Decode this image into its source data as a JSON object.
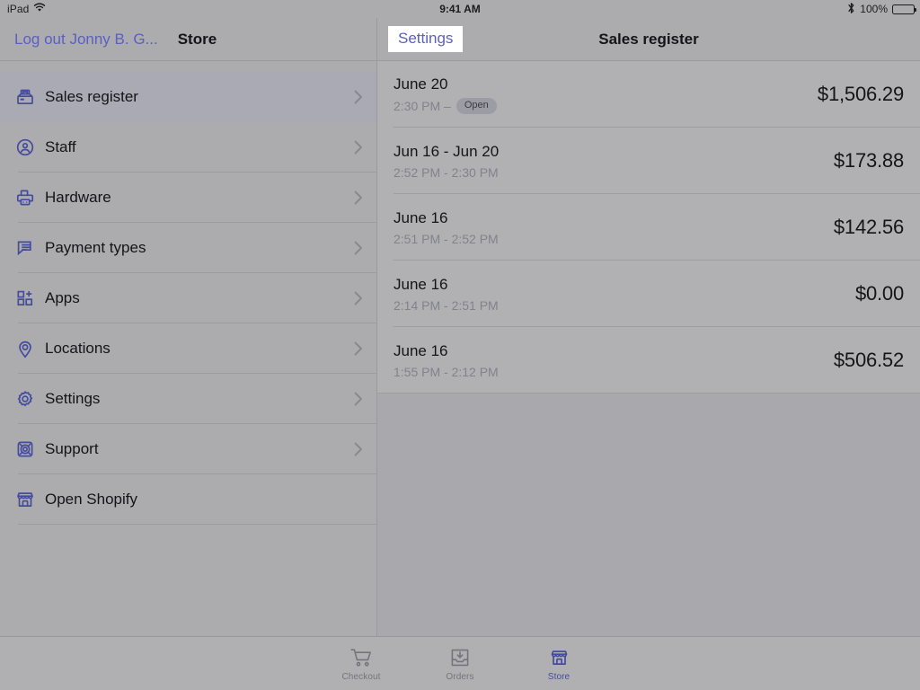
{
  "status_bar": {
    "device": "iPad",
    "wifi_icon": "wifi-icon",
    "time": "9:41 AM",
    "bluetooth_icon": "bluetooth-icon",
    "battery_percent": "100%",
    "battery_icon": "battery-full-icon"
  },
  "left_pane": {
    "navbar": {
      "logout_label": "Log out Jonny B. G...",
      "title": "Store"
    },
    "menu_items": [
      {
        "label": "Sales register",
        "icon": "cash-register-icon",
        "selected": true,
        "chevron": true
      },
      {
        "label": "Staff",
        "icon": "user-circle-icon",
        "selected": false,
        "chevron": true
      },
      {
        "label": "Hardware",
        "icon": "printer-icon",
        "selected": false,
        "chevron": true
      },
      {
        "label": "Payment types",
        "icon": "cards-stack-icon",
        "selected": false,
        "chevron": true
      },
      {
        "label": "Apps",
        "icon": "apps-grid-plus-icon",
        "selected": false,
        "chevron": true
      },
      {
        "label": "Locations",
        "icon": "map-pin-icon",
        "selected": false,
        "chevron": true
      },
      {
        "label": "Settings",
        "icon": "gear-icon",
        "selected": false,
        "chevron": true
      },
      {
        "label": "Support",
        "icon": "lifebuoy-icon",
        "selected": false,
        "chevron": true
      },
      {
        "label": "Open Shopify",
        "icon": "storefront-icon",
        "selected": false,
        "chevron": false
      }
    ]
  },
  "right_pane": {
    "navbar": {
      "settings_label": "Settings",
      "title": "Sales register"
    },
    "sales": [
      {
        "date": "June 20",
        "time": "2:30 PM –",
        "badge": "Open",
        "amount": "$1,506.29"
      },
      {
        "date": "Jun 16 - Jun 20",
        "time": "2:52 PM - 2:30 PM",
        "badge": "",
        "amount": "$173.88"
      },
      {
        "date": "June 16",
        "time": "2:51 PM - 2:52 PM",
        "badge": "",
        "amount": "$142.56"
      },
      {
        "date": "June 16",
        "time": "2:14 PM - 2:51 PM",
        "badge": "",
        "amount": "$0.00"
      },
      {
        "date": "June 16",
        "time": "1:55 PM - 2:12 PM",
        "badge": "",
        "amount": "$506.52"
      }
    ]
  },
  "tab_bar": {
    "tabs": [
      {
        "label": "Checkout",
        "icon": "shopping-cart-icon",
        "active": false
      },
      {
        "label": "Orders",
        "icon": "inbox-download-icon",
        "active": false
      },
      {
        "label": "Store",
        "icon": "storefront-icon",
        "active": true
      }
    ]
  },
  "colors": {
    "accent": "#454b9e",
    "link": "#5c5fbf",
    "background": "#acacaf",
    "list_background": "#b1b1b4",
    "selected_row": "#a9aab3",
    "separator": "#9b9ba1",
    "muted_text": "#82828c",
    "tab_inactive": "#74747c"
  }
}
